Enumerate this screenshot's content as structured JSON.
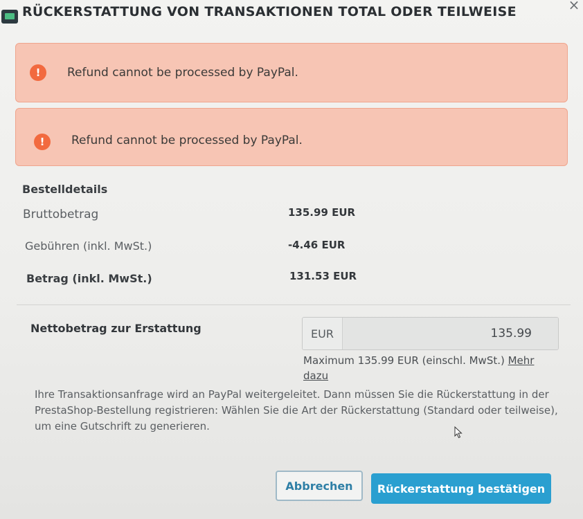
{
  "dialog": {
    "title": "RÜCKERSTATTUNG VON TRANSAKTIONEN TOTAL ODER TEILWEISE"
  },
  "alerts": [
    {
      "icon": "exclamation-icon",
      "text": "Refund cannot be processed by PayPal."
    },
    {
      "icon": "exclamation-icon",
      "text": "Refund cannot be processed by PayPal."
    }
  ],
  "order_details": {
    "title": "Bestelldetails",
    "rows": [
      {
        "label": "Bruttobetrag",
        "value": "135.99 EUR"
      },
      {
        "label": "Gebühren (inkl. MwSt.)",
        "value": "-4.46 EUR"
      },
      {
        "label": "Betrag (inkl. MwSt.)",
        "value": "131.53 EUR"
      }
    ]
  },
  "refund": {
    "label": "Nettobetrag zur Erstattung",
    "currency": "EUR",
    "amount": "135.99",
    "help_text": "Maximum 135.99 EUR (einschl. MwSt.) ",
    "help_link": "Mehr dazu"
  },
  "info_text": "Ihre Transaktionsanfrage wird an PayPal weitergeleitet. Dann müssen Sie die Rückerstattung in der PrestaShop-Bestellung registrieren: Wählen Sie die Art der Rückerstattung (Standard oder teilweise), um eine Gutschrift zu generieren.",
  "buttons": {
    "cancel": "Abbrechen",
    "confirm": "Rückerstattung bestätigen"
  },
  "colors": {
    "alert_bg": "#f7c5b4",
    "alert_icon": "#f26a3f",
    "primary": "#2a9fd0"
  }
}
